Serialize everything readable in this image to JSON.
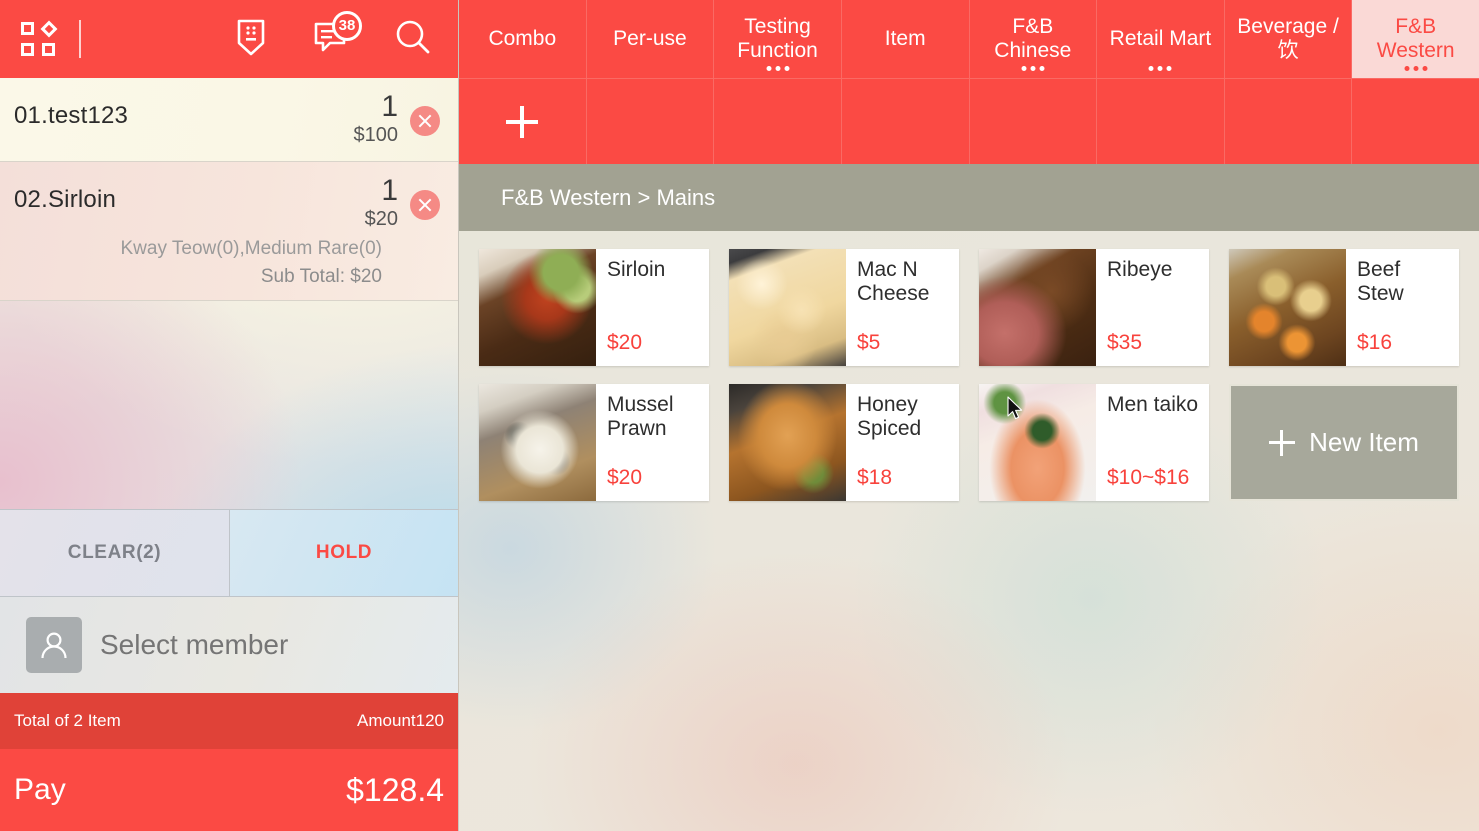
{
  "header": {
    "app_icon": "grid-logo-icon",
    "icons": [
      {
        "name": "receipt-download-icon"
      },
      {
        "name": "chat-message-icon",
        "badge": "38"
      },
      {
        "name": "search-icon"
      }
    ]
  },
  "order": {
    "items": [
      {
        "label": "01.test123",
        "qty": "1",
        "price": "$100",
        "modifiers": "",
        "subtotal": "",
        "delete_icon": "delete-circle-icon"
      },
      {
        "label": "02.Sirloin",
        "qty": "1",
        "price": "$20",
        "modifiers": "Kway Teow(0),Medium Rare(0)",
        "subtotal": "Sub Total: $20",
        "delete_icon": "delete-circle-icon"
      }
    ],
    "clear_label": "CLEAR(2)",
    "hold_label": "HOLD",
    "member_placeholder": "Select member",
    "member_value": "",
    "avatar_icon": "person-avatar-icon",
    "coupon_icon": "ticket-coupon-icon",
    "total_items_label": "Total of 2 Item",
    "amount_label": "Amount120",
    "pay_label": "Pay",
    "pay_amount": "$128.4"
  },
  "tabs": [
    {
      "label": "Combo",
      "active": false,
      "has_dots": false
    },
    {
      "label": "Per-use",
      "active": false,
      "has_dots": false
    },
    {
      "label": "Testing Function",
      "active": false,
      "has_dots": true
    },
    {
      "label": "Item",
      "active": false,
      "has_dots": false
    },
    {
      "label": "F&B Chinese",
      "active": false,
      "has_dots": true
    },
    {
      "label": "Retail Mart",
      "active": false,
      "has_dots": true
    },
    {
      "label": "Beverage / 饮",
      "active": false,
      "has_dots": false
    },
    {
      "label": "F&B Western",
      "active": true,
      "has_dots": true
    }
  ],
  "subtabs": {
    "add_icon": "plus-icon",
    "count": 8
  },
  "breadcrumb": "F&B Western > Mains",
  "products": [
    {
      "name": "Sirloin",
      "price": "$20",
      "image": "grilled-steak-photo"
    },
    {
      "name": "Mac N Cheese",
      "price": "$5",
      "image": "macaroni-cheese-photo"
    },
    {
      "name": "Ribeye",
      "price": "$35",
      "image": "ribeye-steak-photo"
    },
    {
      "name": "Beef Stew",
      "price": "$16",
      "image": "beef-stew-photo"
    },
    {
      "name": "Mussel Prawn",
      "price": "$20",
      "image": "mussel-risotto-photo"
    },
    {
      "name": "Honey Spiced",
      "price": "$18",
      "image": "roast-chicken-photo"
    },
    {
      "name": "Men taiko",
      "price": "$10~$16",
      "image": "mentaiko-pasta-photo"
    }
  ],
  "new_item_label": "New Item",
  "colors": {
    "brand_red": "#fb4a44",
    "total_bar_red": "#e04238",
    "active_tab_bg": "#fad9d6",
    "price_red": "#f8423c",
    "breadcrumb_bg": "#969686",
    "new_item_bg": "#a0a194"
  }
}
